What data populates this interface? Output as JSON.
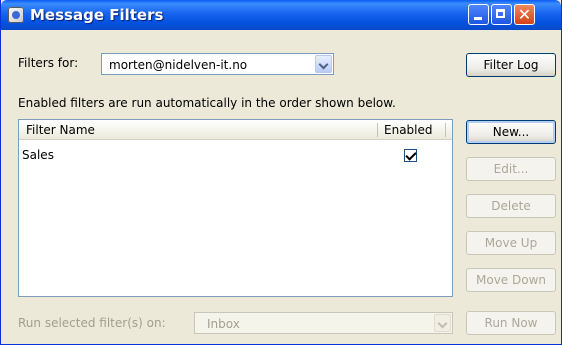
{
  "window": {
    "title": "Message Filters"
  },
  "filters_for": {
    "label": "Filters for:",
    "account": "morten@nidelven-it.no"
  },
  "buttons": {
    "filter_log": "Filter Log",
    "new": "New...",
    "edit": "Edit...",
    "delete": "Delete",
    "move_up": "Move Up",
    "move_down": "Move Down",
    "run_now": "Run Now"
  },
  "info_text": "Enabled filters are run automatically in the order shown below.",
  "list": {
    "columns": {
      "name": "Filter Name",
      "enabled": "Enabled"
    },
    "rows": [
      {
        "name": "Sales",
        "enabled": true
      }
    ]
  },
  "run_on": {
    "label": "Run selected filter(s) on:",
    "folder": "Inbox"
  }
}
